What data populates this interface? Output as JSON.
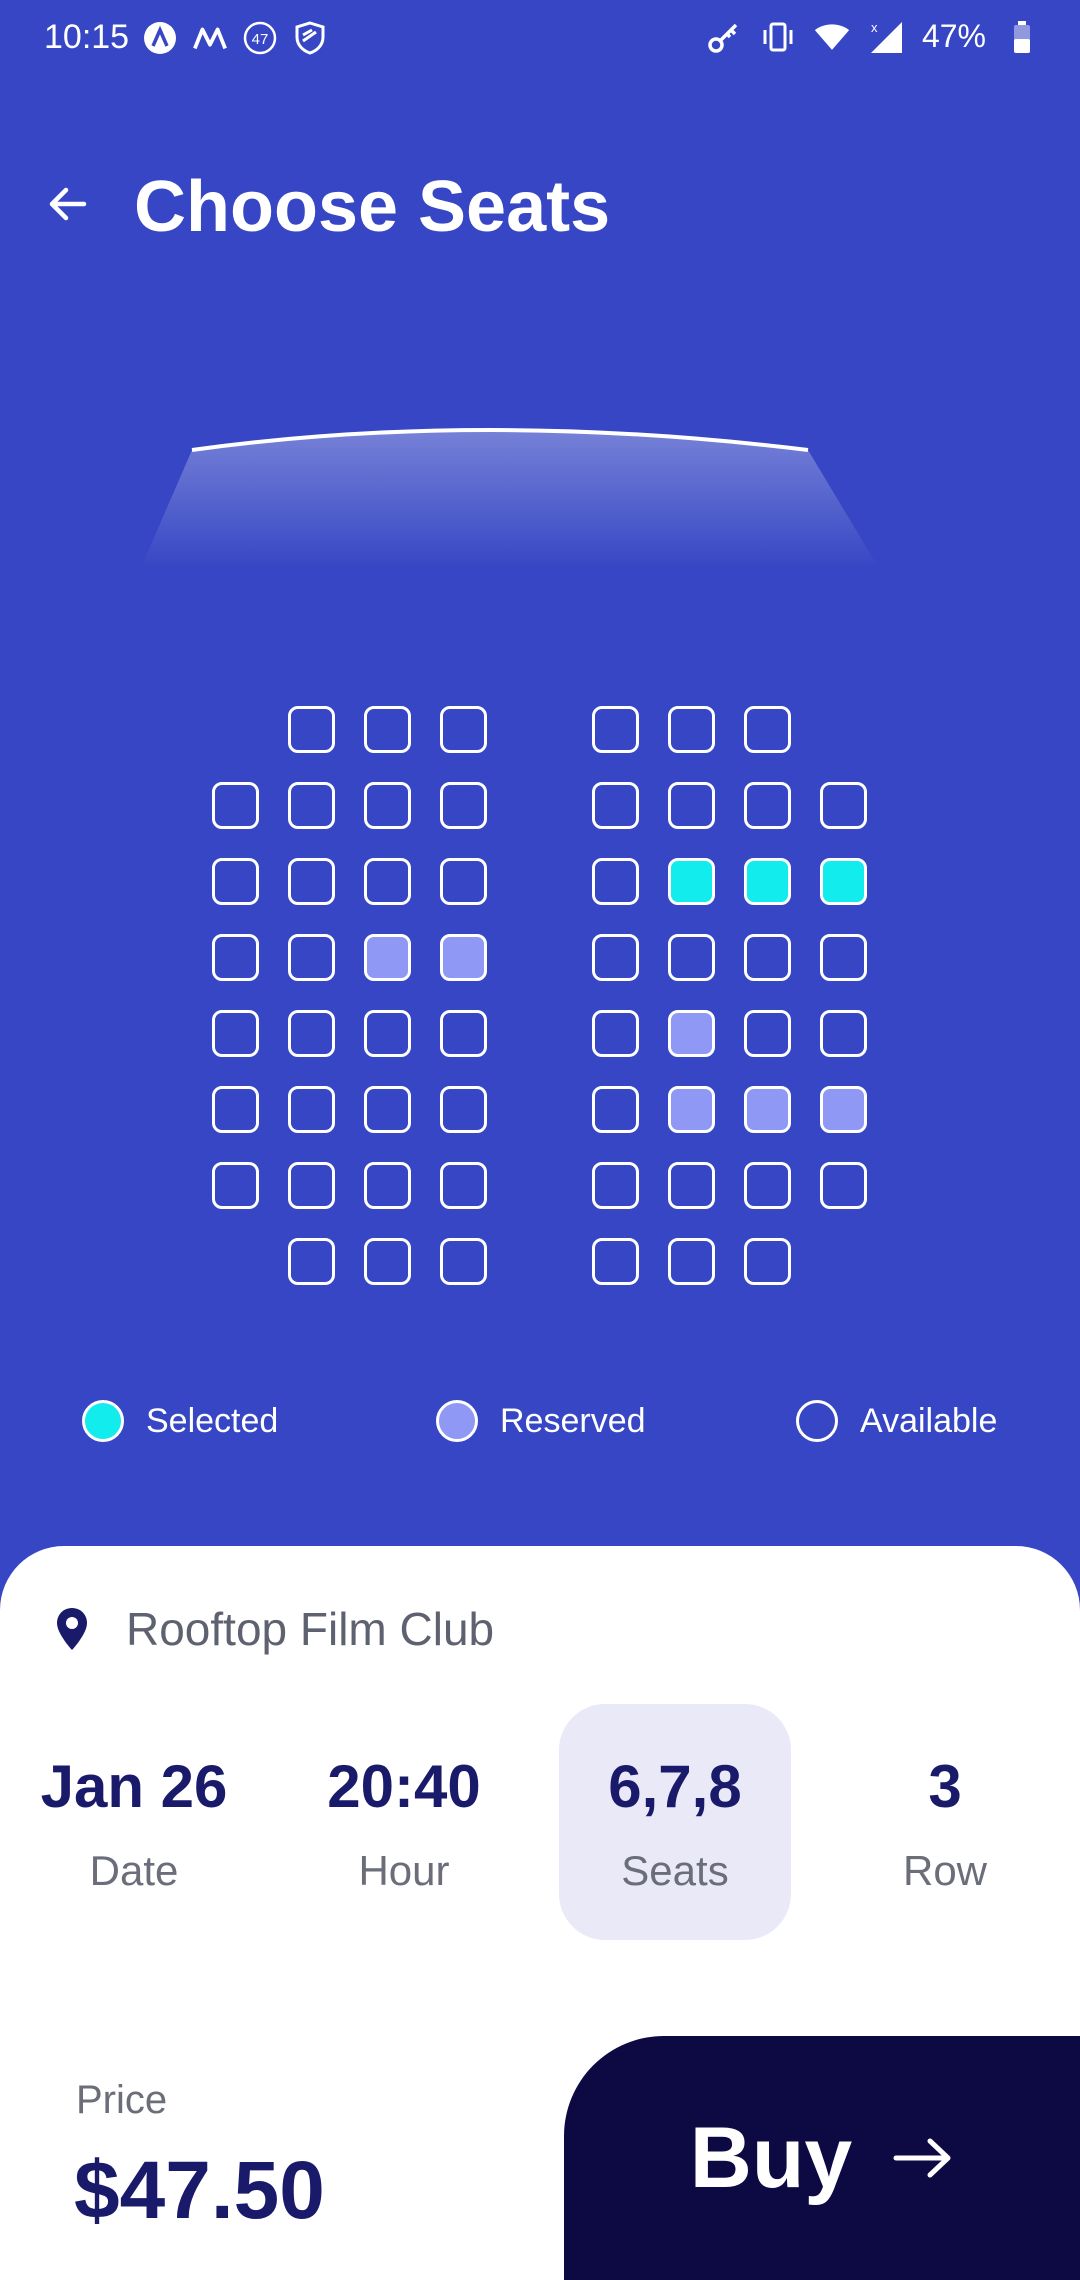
{
  "status_bar": {
    "time": "10:15",
    "left_icons": [
      "app-icon-a",
      "app-icon-m",
      "notification-count-47",
      "shield-icon"
    ],
    "notification_count": "47",
    "right_icons": [
      "key-icon",
      "vibrate-icon",
      "wifi-icon",
      "signal-icon",
      "battery-icon"
    ],
    "battery_percent": "47%"
  },
  "header": {
    "back_icon": "arrow-left-icon",
    "title": "Choose Seats"
  },
  "seat_map": {
    "colors": {
      "available_border": "#ffffff",
      "reserved": "#8f98f5",
      "selected": "#13ecec",
      "background": "#3646c4"
    },
    "rows": [
      {
        "left": [
          null,
          "available",
          "available",
          "available"
        ],
        "right": [
          "available",
          "available",
          "available",
          null
        ]
      },
      {
        "left": [
          "available",
          "available",
          "available",
          "available"
        ],
        "right": [
          "available",
          "available",
          "available",
          "available"
        ]
      },
      {
        "left": [
          "available",
          "available",
          "available",
          "available"
        ],
        "right": [
          "available",
          "selected",
          "selected",
          "selected"
        ]
      },
      {
        "left": [
          "available",
          "available",
          "reserved",
          "reserved"
        ],
        "right": [
          "available",
          "available",
          "available",
          "available"
        ]
      },
      {
        "left": [
          "available",
          "available",
          "available",
          "available"
        ],
        "right": [
          "available",
          "reserved",
          "available",
          "available"
        ]
      },
      {
        "left": [
          "available",
          "available",
          "available",
          "available"
        ],
        "right": [
          "available",
          "reserved",
          "reserved",
          "reserved"
        ]
      },
      {
        "left": [
          "available",
          "available",
          "available",
          "available"
        ],
        "right": [
          "available",
          "available",
          "available",
          "available"
        ]
      },
      {
        "left": [
          null,
          "available",
          "available",
          "available"
        ],
        "right": [
          "available",
          "available",
          "available",
          null
        ]
      }
    ]
  },
  "legend": {
    "selected": "Selected",
    "reserved": "Reserved",
    "available": "Available"
  },
  "booking": {
    "venue_icon": "map-pin-icon",
    "venue": "Rooftop Film Club",
    "info": [
      {
        "value": "Jan 26",
        "label": "Date",
        "active": false
      },
      {
        "value": "20:40",
        "label": "Hour",
        "active": false
      },
      {
        "value": "6,7,8",
        "label": "Seats",
        "active": true
      },
      {
        "value": "3",
        "label": "Row",
        "active": false
      }
    ],
    "price_label": "Price",
    "price": "$47.50",
    "buy_label": "Buy",
    "buy_icon": "arrow-right-icon"
  }
}
